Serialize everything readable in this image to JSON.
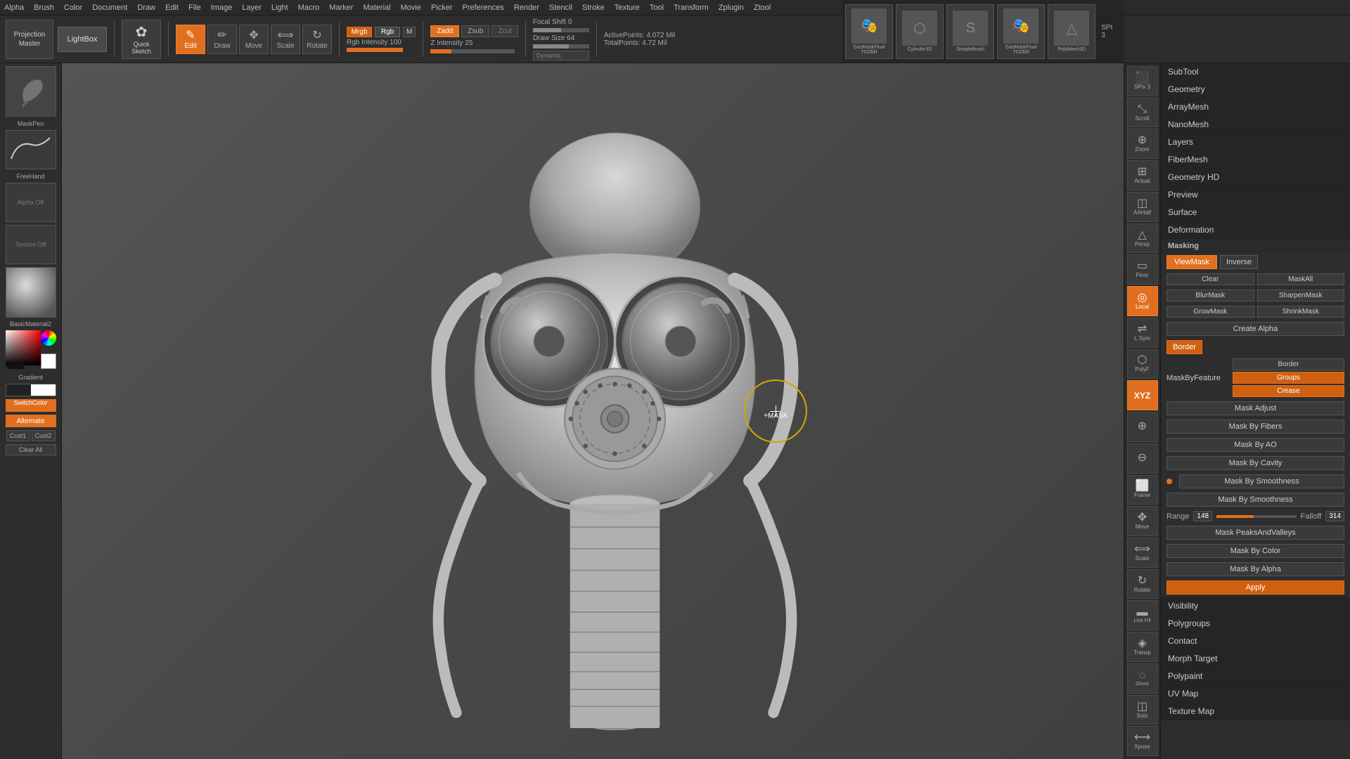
{
  "topMenu": {
    "items": [
      "Alpha",
      "Brush",
      "Color",
      "Document",
      "Draw",
      "Edit",
      "File",
      "Image",
      "Layer",
      "Light",
      "Macro",
      "Marker",
      "Material",
      "Movie",
      "Picker",
      "Preferences",
      "Render",
      "Stencil",
      "Stroke",
      "Texture",
      "Tool",
      "Transform",
      "Zplugin",
      "Ztool"
    ]
  },
  "toolbar": {
    "projectionMaster": "Projection\nMaster",
    "lightbox": "LightBox",
    "quickSketch": "Quick\nSketch",
    "edit": "Edit",
    "draw": "Draw",
    "move": "Move",
    "scale": "Scale",
    "rotate": "Rotate",
    "mrgb": "Mrgb",
    "rgb": "Rgb",
    "m_btn": "M",
    "rgbIntensity": "Rgb Intensity 100",
    "zadd": "Zadd",
    "zsub": "Zsub",
    "zcut": "Zcut",
    "zIntensity": "Z Intensity 25",
    "focalShift": "Focal Shift 0",
    "drawSize": "Draw Size 64",
    "dynamic": "Dynamic",
    "activePoints": "ActivePoints: 4.072 Mil",
    "totalPoints": "TotalPoints: 4.72 Mil"
  },
  "leftPanel": {
    "brushLabel": "MaskPen",
    "freehandLabel": "FreeHand",
    "alphaOff": "Alpha Off",
    "textureOff": "Texture Off",
    "materialLabel": "BasicMaterial2",
    "gradientLabel": "Gradient",
    "switchColor": "SwitchColor",
    "alternate": "Alternate",
    "cust1": "Cust1",
    "cust2": "Cust2",
    "clearAll": "Clear All"
  },
  "cursor": {
    "label": "+MASK"
  },
  "rightIcons": {
    "buttons": [
      {
        "label": "SPix 3",
        "symbol": "▣",
        "isOrange": false
      },
      {
        "label": "Scroll",
        "symbol": "⤢",
        "isOrange": false
      },
      {
        "label": "Zoom",
        "symbol": "⊕",
        "isOrange": false
      },
      {
        "label": "Actual",
        "symbol": "⊞",
        "isOrange": false
      },
      {
        "label": "AAHalf",
        "symbol": "◫",
        "isOrange": false
      },
      {
        "label": "Persp",
        "symbol": "△",
        "isOrange": false
      },
      {
        "label": "Floor",
        "symbol": "▭",
        "isOrange": false
      },
      {
        "label": "Local",
        "symbol": "◎",
        "isOrange": true
      },
      {
        "label": "L.Sym",
        "symbol": "⇌",
        "isOrange": false
      },
      {
        "label": "PolyF",
        "symbol": "⬡",
        "isOrange": false
      },
      {
        "label": "XYZ",
        "symbol": "xyz",
        "isOrange": true
      },
      {
        "label": "",
        "symbol": "⊕",
        "isOrange": false
      },
      {
        "label": "",
        "symbol": "⊖",
        "isOrange": false
      },
      {
        "label": "Frame",
        "symbol": "⬜",
        "isOrange": false
      },
      {
        "label": "Move",
        "symbol": "✥",
        "isOrange": false
      },
      {
        "label": "Scale",
        "symbol": "⟺",
        "isOrange": false
      },
      {
        "label": "Rotate",
        "symbol": "↻",
        "isOrange": false
      },
      {
        "label": "Line Fill",
        "symbol": "▬",
        "isOrange": false
      },
      {
        "label": "Transp",
        "symbol": "◈",
        "isOrange": false
      },
      {
        "label": "Ghost Solo",
        "symbol": "◌",
        "isOrange": false
      },
      {
        "label": "Transp",
        "symbol": "◫",
        "isOrange": false
      },
      {
        "label": "Xpose",
        "symbol": "⟷",
        "isOrange": false
      }
    ]
  },
  "modelThumbs": [
    {
      "label": "GasMaskFinalTOZBR",
      "active": false
    },
    {
      "label": "Cylinder3D",
      "active": false
    },
    {
      "label": "SimpleBrush",
      "active": false
    },
    {
      "label": "GasMaskFinalTOZBR",
      "active": false
    },
    {
      "label": "PolyMesh3D",
      "active": false
    }
  ],
  "sptLabel": "SPt 3",
  "rightPanel": {
    "subtool": "SubTool",
    "geometry": "Geometry",
    "arraymesh": "ArrayMesh",
    "nanomesh": "NanoMesh",
    "layers": "Layers",
    "fibermesh": "FiberMesh",
    "geometryHD": "Geometry HD",
    "preview": "Preview",
    "surface": "Surface",
    "deformation": "Deformation",
    "masking": "Masking",
    "viewMask": "ViewMask",
    "inverse": "Inverse",
    "clear": "Clear",
    "maskAll": "MaskAll",
    "blurMask": "BlurMask",
    "sharpenMask": "SharpenMask",
    "growMask": "GrowMask",
    "shrinkMask": "ShrinkMask",
    "createAlpha": "Create Alpha",
    "border": "Border",
    "groups": "Groups",
    "crease": "Crease",
    "maskByFeature": "MaskByFeature",
    "maskAdjust": "Mask Adjust",
    "maskByFibers": "Mask By Fibers",
    "maskByAO": "Mask By AO",
    "maskByCavity": "Mask By Cavity",
    "maskBySmoothness": "Mask By Smoothness",
    "maskBySmoothness2": "Mask By Smoothness",
    "rangeLabel": "Range",
    "rangeValue": "148",
    "falloffLabel": "Falloff",
    "falloffValue": "314",
    "maskPeaksAndValleys": "Mask PeaksAndValleys",
    "maskByColor": "Mask By Color",
    "maskByAlpha": "Mask By Alpha",
    "apply": "Apply",
    "visibility": "Visibility",
    "polygroups": "Polygroups",
    "contact": "Contact",
    "morphTarget": "Morph Target",
    "polypaint": "Polypaint",
    "uvMap": "UV Map",
    "textureMap": "Texture Map"
  }
}
